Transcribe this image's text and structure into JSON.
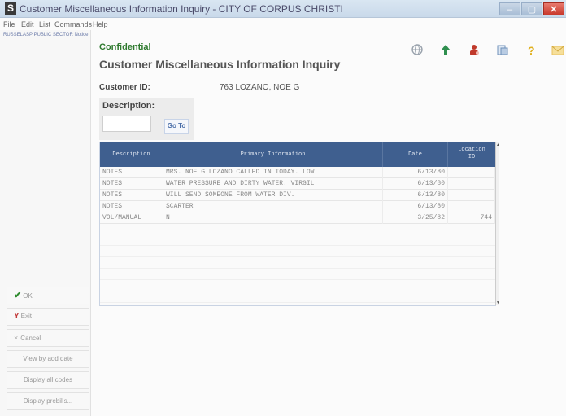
{
  "window": {
    "title": "Customer Miscellaneous Information Inquiry - CITY OF CORPUS CHRISTI",
    "icon_letter": "S",
    "minimize": "–",
    "maximize": "▢",
    "close": "✕"
  },
  "menu": [
    "File",
    "Edit",
    "List",
    "Commands",
    "Help"
  ],
  "sidebar": {
    "user_label": "RUSSELASP PUBLIC SECTOR Notice",
    "buttons": {
      "ok": "OK",
      "exit": "Exit",
      "cancel": "Cancel",
      "view_by_add_date": "View by add date",
      "display_all_codes": "Display all codes",
      "display_prebills": "Display prebills..."
    }
  },
  "toolbar": {
    "icons": [
      "globe-icon",
      "arrow-up-icon",
      "user-settings-icon",
      "reports-icon",
      "help-icon",
      "mail-icon"
    ],
    "colors": {
      "globe": "#9aa3ad",
      "arrow": "#2f8f4f",
      "user": "#c0392b",
      "reports": "#6d8fb8",
      "help": "#e0b020",
      "mail": "#e8c260"
    }
  },
  "content": {
    "confidential": "Confidential",
    "title": "Customer Miscellaneous Information Inquiry",
    "customer_id_label": "Customer ID:",
    "customer_id_value": "763 LOZANO, NOE G",
    "description_label": "Description:",
    "description_value": "",
    "goto_label": "Go To"
  },
  "grid": {
    "headers": {
      "description": "Description",
      "primary_information": "Primary Information",
      "date": "Date",
      "location_line1": "Location",
      "location_line2": "ID"
    },
    "rows": [
      {
        "description": "NOTES",
        "primary_information": "MRS. NOE G LOZANO CALLED IN TODAY. LOW",
        "date": "6/13/80",
        "location_id": ""
      },
      {
        "description": "NOTES",
        "primary_information": "WATER PRESSURE AND DIRTY WATER.  VIRGIL",
        "date": "6/13/80",
        "location_id": ""
      },
      {
        "description": "NOTES",
        "primary_information": "WILL SEND SOMEONE FROM WATER DIV.",
        "date": "6/13/80",
        "location_id": ""
      },
      {
        "description": "NOTES",
        "primary_information": "SCARTER",
        "date": "6/13/80",
        "location_id": ""
      },
      {
        "description": "VOL/MANUAL",
        "primary_information": "N",
        "date": "3/25/82",
        "location_id": "744"
      }
    ]
  },
  "colors": {
    "accent_green": "#2f7a2f",
    "grid_header": "#3f5f8f",
    "close_red": "#c8392c"
  }
}
